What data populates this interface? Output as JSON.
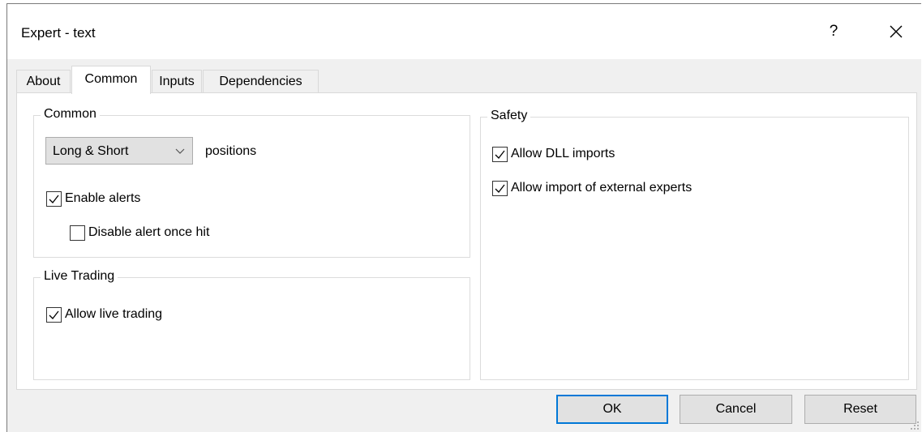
{
  "window": {
    "title": "Expert - text",
    "help_label": "?"
  },
  "tabs": [
    {
      "label": "About",
      "active": false
    },
    {
      "label": "Common",
      "active": true
    },
    {
      "label": "Inputs",
      "active": false
    },
    {
      "label": "Dependencies",
      "active": false
    }
  ],
  "common_group": {
    "title": "Common",
    "positions_select": {
      "value": "Long & Short"
    },
    "positions_label": "positions",
    "enable_alerts": {
      "label": "Enable alerts",
      "checked": true
    },
    "disable_alert_once_hit": {
      "label": "Disable alert once hit",
      "checked": false
    }
  },
  "live_trading_group": {
    "title": "Live Trading",
    "allow_live_trading": {
      "label": "Allow live trading",
      "checked": true
    }
  },
  "safety_group": {
    "title": "Safety",
    "allow_dll_imports": {
      "label": "Allow DLL imports",
      "checked": true
    },
    "allow_external_experts": {
      "label": "Allow import of external experts",
      "checked": true
    }
  },
  "buttons": {
    "ok": "OK",
    "cancel": "Cancel",
    "reset": "Reset"
  }
}
